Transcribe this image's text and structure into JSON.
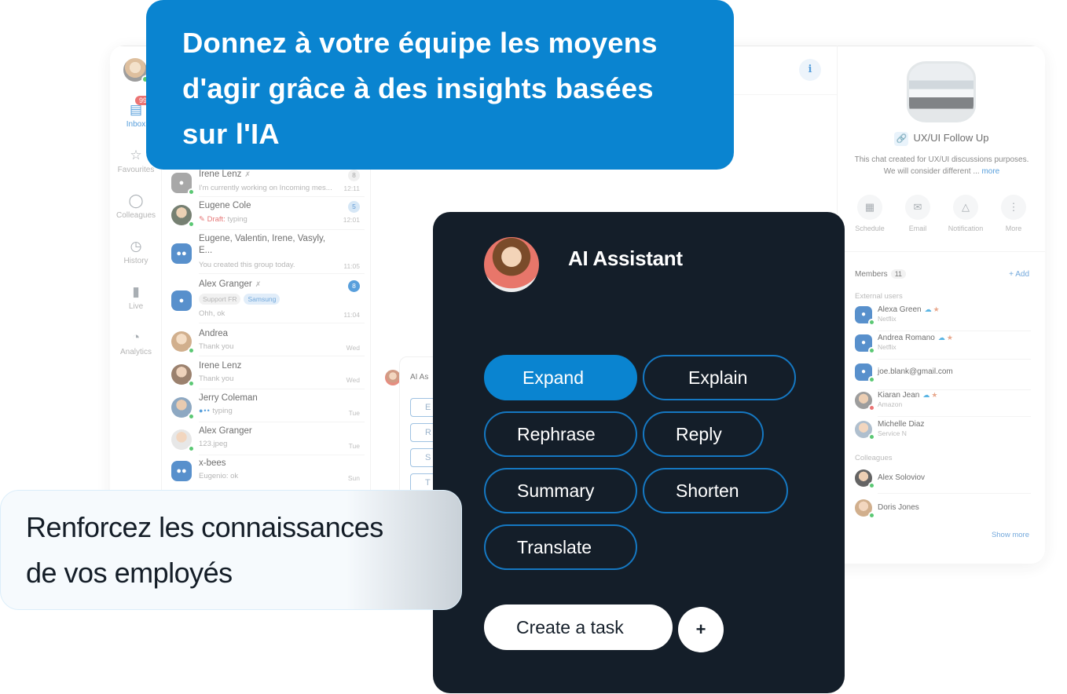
{
  "banner": {
    "lines": [
      "Donnez à votre équipe les moyens",
      "d'agir grâce à des insights basées",
      "sur l'IA"
    ]
  },
  "knowledge_card": {
    "lines": [
      "Renforcez les connaissances",
      "de vos employés"
    ]
  },
  "nav": {
    "inbox_badge": "99",
    "items": [
      {
        "label": "Inbox",
        "icon": "inbox-icon"
      },
      {
        "label": "Favourites",
        "icon": "star-icon"
      },
      {
        "label": "Colleagues",
        "icon": "users-icon"
      },
      {
        "label": "History",
        "icon": "clock-icon"
      },
      {
        "label": "Live",
        "icon": "bar-chart-icon"
      },
      {
        "label": "Analytics",
        "icon": "pie-chart-icon"
      }
    ]
  },
  "conversations": [
    {
      "name": "Irene Lenz",
      "muted": true,
      "preview": "I'm currently working on Incoming mes...",
      "time": "12:11",
      "count": "8"
    },
    {
      "name": "Eugene Cole",
      "draft_label": "Draft:",
      "preview": "typing",
      "time": "12:01",
      "count": "5"
    },
    {
      "name": "Eugene, Valentin, Irene, Vasyly,",
      "name2": "E...",
      "preview": "You created this group today.",
      "time": "11:05"
    },
    {
      "name": "Alex Granger",
      "muted": true,
      "tags": [
        "Support FR",
        "Samsung"
      ],
      "preview": "Ohh, ok",
      "time": "11:04",
      "count": "8"
    },
    {
      "name": "Andrea",
      "preview": "Thank you",
      "time": "Wed"
    },
    {
      "name": "Irene Lenz",
      "preview": "Thank you",
      "time": "Wed"
    },
    {
      "name": "Jerry Coleman",
      "preview": "typing",
      "time": "Tue"
    },
    {
      "name": "Alex Granger",
      "preview": "123.jpeg",
      "time": "Tue"
    },
    {
      "name": "x-bees",
      "preview": "Eugenio: ok",
      "time": "Sun"
    }
  ],
  "header": {
    "info_icon": "i"
  },
  "mini_ai": {
    "title": "AI As",
    "buttons": [
      "E",
      "R",
      "S",
      "T"
    ]
  },
  "details": {
    "title": "UX/UI Follow Up",
    "description_line1": "This chat created for UX/UI discussions purposes.",
    "description_line2": "We will consider different ...",
    "more": "more",
    "actions": [
      "Schedule",
      "Email",
      "Notification",
      "More"
    ],
    "members_label": "Members",
    "members_count": "11",
    "add_label": "+ Add",
    "external_label": "External users",
    "external": [
      {
        "name": "Alexa Green",
        "company": "Netflix",
        "salesforce": true,
        "status": "online"
      },
      {
        "name": "Andrea Romano",
        "company": "Netflix",
        "salesforce": true,
        "status": "online"
      },
      {
        "name": "joe.blank@gmail.com",
        "company": "",
        "status": "online"
      },
      {
        "name": "Kiaran Jean",
        "company": "Amazon",
        "salesforce": true,
        "status": "busy"
      },
      {
        "name": "Michelle Diaz",
        "company": "Service N",
        "status": "online"
      }
    ],
    "colleagues_label": "Colleagues",
    "colleagues": [
      {
        "name": "Alex Soloviov",
        "status": "online"
      },
      {
        "name": "Doris Jones",
        "status": "online"
      }
    ],
    "show_more": "Show more"
  },
  "ai_assistant": {
    "title": "AI Assistant",
    "actions": [
      {
        "label": "Expand",
        "selected": true
      },
      {
        "label": "Explain",
        "selected": false
      },
      {
        "label": "Rephrase",
        "selected": false
      },
      {
        "label": "Reply",
        "selected": false
      },
      {
        "label": "Summary",
        "selected": false
      },
      {
        "label": "Shorten",
        "selected": false
      },
      {
        "label": "Translate",
        "selected": false
      }
    ],
    "create_task": "Create a task",
    "plus": "+"
  },
  "colors": {
    "brand_blue": "#0a84d0",
    "dark_panel": "#141e29",
    "online": "#3fbf5c",
    "busy": "#e85c5c"
  }
}
